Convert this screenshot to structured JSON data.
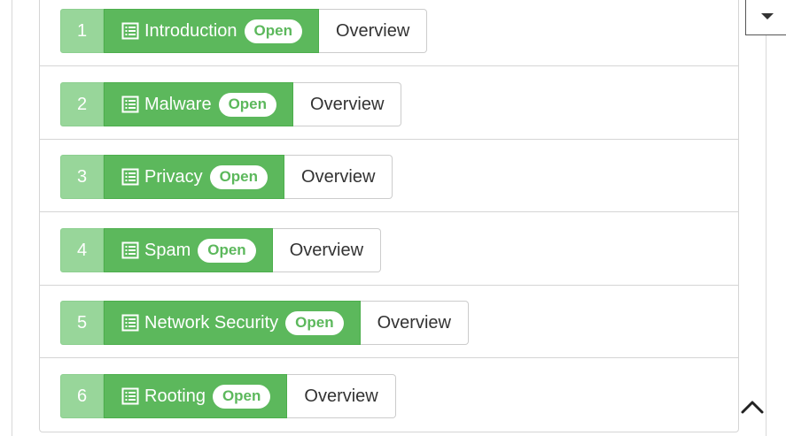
{
  "modules": [
    {
      "number": "1",
      "title": "Introduction",
      "badge": "Open",
      "overview_label": "Overview"
    },
    {
      "number": "2",
      "title": "Malware",
      "badge": "Open",
      "overview_label": "Overview"
    },
    {
      "number": "3",
      "title": "Privacy",
      "badge": "Open",
      "overview_label": "Overview"
    },
    {
      "number": "4",
      "title": "Spam",
      "badge": "Open",
      "overview_label": "Overview"
    },
    {
      "number": "5",
      "title": "Network Security",
      "badge": "Open",
      "overview_label": "Overview"
    },
    {
      "number": "6",
      "title": "Rooting",
      "badge": "Open",
      "overview_label": "Overview"
    }
  ],
  "icons": {
    "module_icon": "list-document-icon",
    "dropdown_icon": "caret-down-icon",
    "scroll_top_icon": "chevron-up-icon"
  },
  "colors": {
    "primary_green": "#5cb85c",
    "number_green": "#98d69a",
    "badge_bg": "#ffffff",
    "overview_text": "#333333"
  }
}
